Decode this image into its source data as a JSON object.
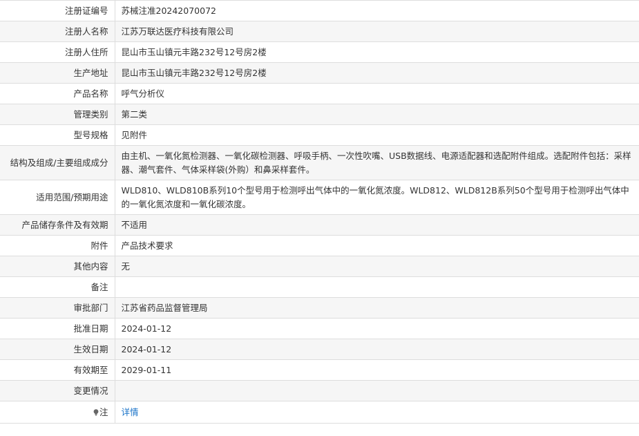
{
  "rows": [
    {
      "label": "注册证编号",
      "value": "苏械注准20242070072"
    },
    {
      "label": "注册人名称",
      "value": "江苏万联达医疗科技有限公司"
    },
    {
      "label": "注册人住所",
      "value": "昆山市玉山镇元丰路232号12号房2楼"
    },
    {
      "label": "生产地址",
      "value": "昆山市玉山镇元丰路232号12号房2楼"
    },
    {
      "label": "产品名称",
      "value": "呼气分析仪"
    },
    {
      "label": "管理类别",
      "value": "第二类"
    },
    {
      "label": "型号规格",
      "value": "见附件"
    },
    {
      "label": "结构及组成/主要组成成分",
      "value": "由主机、一氧化氮检测器、一氧化碳检测器、呼吸手柄、一次性吹嘴、USB数据线、电源适配器和选配附件组成。选配附件包括：采样器、潮气套件、气体采样袋(外购）和鼻采样套件。"
    },
    {
      "label": "适用范围/预期用途",
      "value": "WLD810、WLD810B系列10个型号用于检测呼出气体中的一氧化氮浓度。WLD812、WLD812B系列50个型号用于检测呼出气体中的一氧化氮浓度和一氧化碳浓度。"
    },
    {
      "label": "产品储存条件及有效期",
      "value": "不适用"
    },
    {
      "label": "附件",
      "value": "产品技术要求"
    },
    {
      "label": "其他内容",
      "value": "无"
    },
    {
      "label": "备注",
      "value": ""
    },
    {
      "label": "审批部门",
      "value": "江苏省药品监督管理局"
    },
    {
      "label": "批准日期",
      "value": "2024-01-12"
    },
    {
      "label": "生效日期",
      "value": "2024-01-12"
    },
    {
      "label": "有效期至",
      "value": "2029-01-11"
    },
    {
      "label": "变更情况",
      "value": ""
    }
  ],
  "note_row": {
    "icon": "lightbulb-icon",
    "label": "注",
    "link_text": "详情"
  },
  "colors": {
    "border": "#dddddd",
    "alt_row_bg": "#f6f6f6",
    "text": "#333333",
    "link": "#1a73c8"
  }
}
